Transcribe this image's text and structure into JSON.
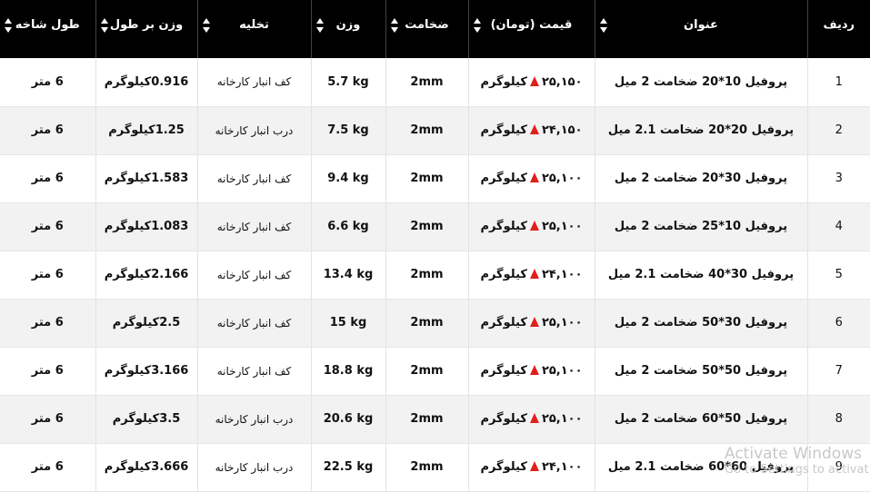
{
  "table": {
    "headers": {
      "row": "ردیف",
      "name": "عنوان",
      "price": "قیمت (تومان)",
      "thickness": "ضخامت",
      "weight": "وزن",
      "unload": "تخلیه",
      "weight_per_length": "وزن بر طول",
      "branch_length": "طول شاخه"
    },
    "rows": [
      {
        "row": "1",
        "name": "پروفیل 10*20 ضخامت 2 میل",
        "price": "۲۵,۱۵۰",
        "unit": "کیلوگرم",
        "thickness": "2mm",
        "weight": "5.7 kg",
        "unload": "کف انبار کارخانه",
        "weight_per_length": "0.916کیلوگرم",
        "branch_length": "6 متر"
      },
      {
        "row": "2",
        "name": "پروفیل 20*20 ضخامت 2.1 میل",
        "price": "۲۴,۱۵۰",
        "unit": "کیلوگرم",
        "thickness": "2mm",
        "weight": "7.5 kg",
        "unload": "درب انبار کارخانه",
        "weight_per_length": "1.25کیلوگرم",
        "branch_length": "6 متر"
      },
      {
        "row": "3",
        "name": "پروفیل 30*20 ضخامت 2 میل",
        "price": "۲۵,۱۰۰",
        "unit": "کیلوگرم",
        "thickness": "2mm",
        "weight": "9.4 kg",
        "unload": "کف انبار کارخانه",
        "weight_per_length": "1.583کیلوگرم",
        "branch_length": "6 متر"
      },
      {
        "row": "4",
        "name": "پروفیل 10*25 ضخامت 2 میل",
        "price": "۲۵,۱۰۰",
        "unit": "کیلوگرم",
        "thickness": "2mm",
        "weight": "6.6 kg",
        "unload": "کف انبار کارخانه",
        "weight_per_length": "1.083کیلوگرم",
        "branch_length": "6 متر"
      },
      {
        "row": "5",
        "name": "پروفیل 30*40 ضخامت 2.1 میل",
        "price": "۲۴,۱۰۰",
        "unit": "کیلوگرم",
        "thickness": "2mm",
        "weight": "13.4 kg",
        "unload": "کف انبار کارخانه",
        "weight_per_length": "2.166کیلوگرم",
        "branch_length": "6 متر"
      },
      {
        "row": "6",
        "name": "پروفیل 30*50 ضخامت 2 میل",
        "price": "۲۵,۱۰۰",
        "unit": "کیلوگرم",
        "thickness": "2mm",
        "weight": "15 kg",
        "unload": "کف انبار کارخانه",
        "weight_per_length": "2.5کیلوگرم",
        "branch_length": "6 متر"
      },
      {
        "row": "7",
        "name": "پروفیل 50*50 ضخامت 2 میل",
        "price": "۲۵,۱۰۰",
        "unit": "کیلوگرم",
        "thickness": "2mm",
        "weight": "18.8 kg",
        "unload": "کف انبار کارخانه",
        "weight_per_length": "3.166کیلوگرم",
        "branch_length": "6 متر"
      },
      {
        "row": "8",
        "name": "پروفیل 50*60 ضخامت 2 میل",
        "price": "۲۵,۱۰۰",
        "unit": "کیلوگرم",
        "thickness": "2mm",
        "weight": "20.6 kg",
        "unload": "درب انبار کارخانه",
        "weight_per_length": "3.5کیلوگرم",
        "branch_length": "6 متر"
      },
      {
        "row": "9",
        "name": "پروفیل 60*60 ضخامت 2.1 میل",
        "price": "۲۴,۱۰۰",
        "unit": "کیلوگرم",
        "thickness": "2mm",
        "weight": "22.5 kg",
        "unload": "درب انبار کارخانه",
        "weight_per_length": "3.666کیلوگرم",
        "branch_length": "6 متر"
      }
    ]
  },
  "watermark": {
    "line1": "Activate Windows",
    "line2": "Go to Settings to activat"
  },
  "colors": {
    "header_bg": "#000000",
    "header_text": "#ffffff",
    "arrow_up": "#e0201b",
    "stripe": "#f2f2f2"
  },
  "icons": {
    "sort": "sort-arrows-icon",
    "price_trend": "arrow-up-icon"
  }
}
